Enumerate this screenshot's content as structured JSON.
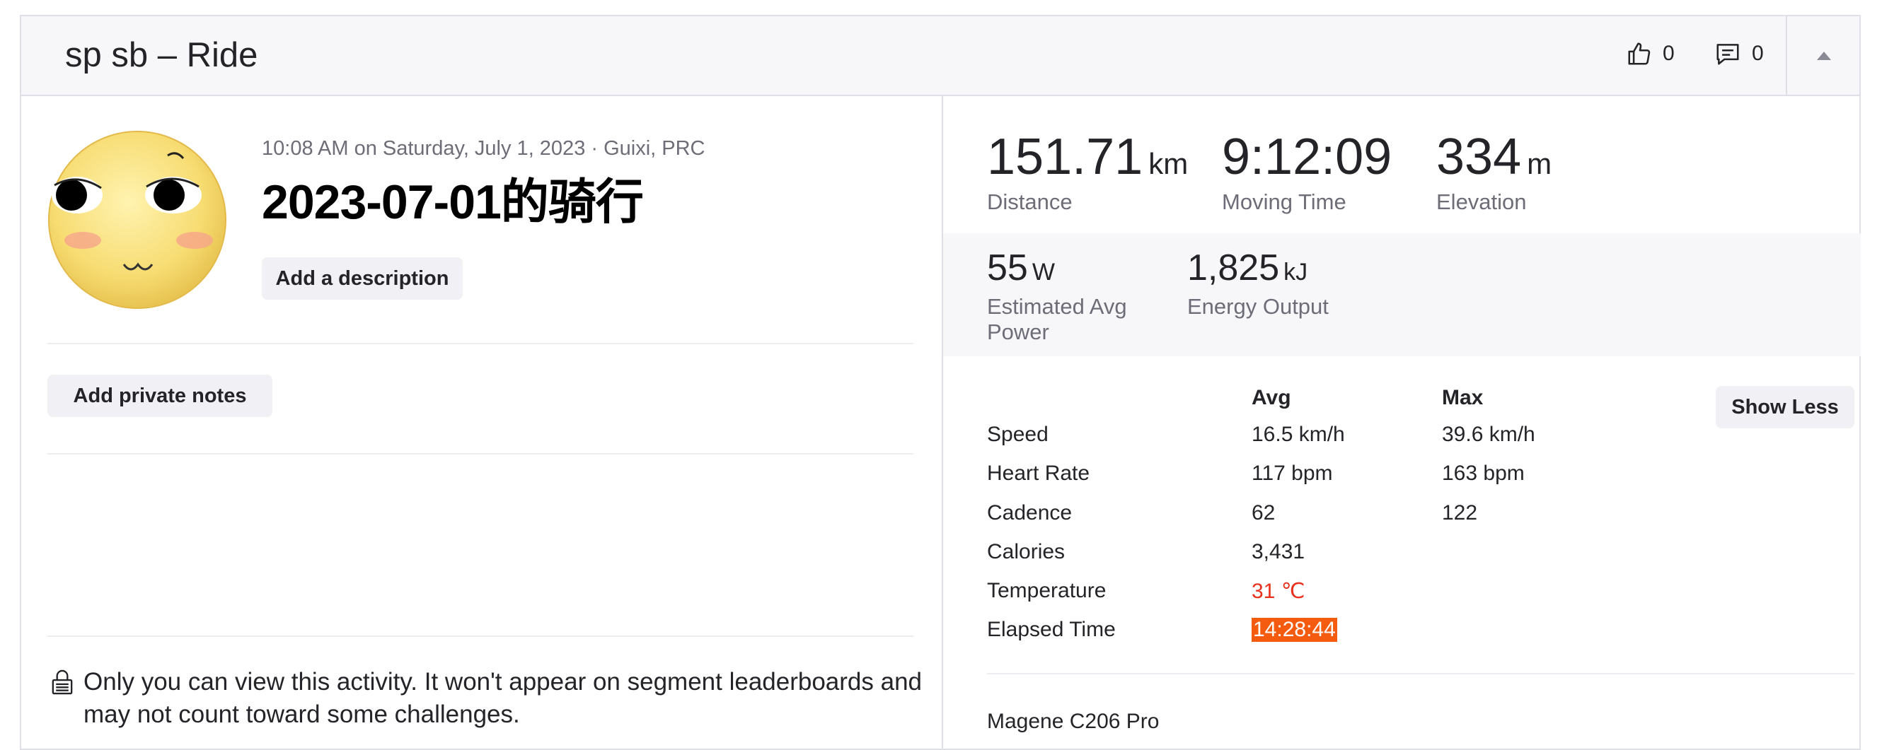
{
  "header": {
    "title": "sp sb – Ride",
    "kudos_count": "0",
    "comments_count": "0"
  },
  "activity": {
    "meta": "10:08 AM on Saturday, July 1, 2023 · Guixi, PRC",
    "title": "2023-07-01的骑行",
    "add_description_label": "Add a description",
    "add_private_notes_label": "Add private notes",
    "privacy_notice": "Only you can view this activity. It won't appear on segment leaderboards and may not count toward some challenges."
  },
  "primary_stats": [
    {
      "value": "151.71",
      "unit": "km",
      "label": "Distance"
    },
    {
      "value": "9:12:09",
      "unit": "",
      "label": "Moving Time"
    },
    {
      "value": "334",
      "unit": "m",
      "label": "Elevation"
    }
  ],
  "secondary_stats": [
    {
      "value": "55",
      "unit": "W",
      "label": "Estimated Avg Power"
    },
    {
      "value": "1,825",
      "unit": "kJ",
      "label": "Energy Output"
    }
  ],
  "details": {
    "col_avg": "Avg",
    "col_max": "Max",
    "show_less_label": "Show Less",
    "rows": [
      {
        "label": "Speed",
        "avg": "16.5 km/h",
        "max": "39.6 km/h"
      },
      {
        "label": "Heart Rate",
        "avg": "117 bpm",
        "max": "163 bpm"
      },
      {
        "label": "Cadence",
        "avg": "62",
        "max": "122"
      },
      {
        "label": "Calories",
        "avg": "3,431",
        "max": ""
      },
      {
        "label": "Temperature",
        "avg": "31 ℃",
        "max": ""
      },
      {
        "label": "Elapsed Time",
        "avg": "14:28:44",
        "max": ""
      }
    ]
  },
  "device": "Magene C206 Pro",
  "icons": {
    "kudos": "thumbs-up-icon",
    "comments": "comment-icon",
    "collapse": "chevron-up-icon",
    "lock": "lock-icon",
    "avatar": "emoji-avatar"
  },
  "colors": {
    "accent": "#f45b0f",
    "temperature": "#e8301c",
    "header_bg": "#f7f7fa",
    "border": "#dfdfe8"
  }
}
